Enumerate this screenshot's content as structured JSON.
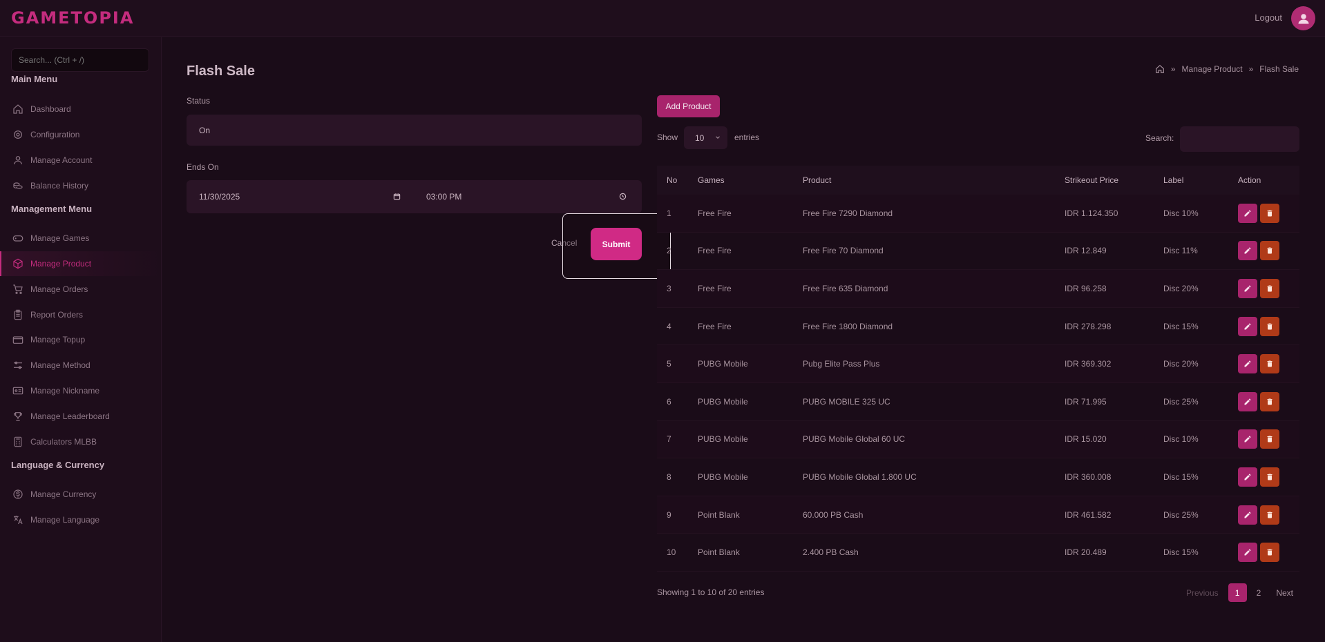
{
  "header": {
    "logo": "GAMETOPIA",
    "logout": "Logout"
  },
  "sidebar": {
    "search_placeholder": "Search... (Ctrl + /)",
    "sections": [
      {
        "title": "Main Menu",
        "items": [
          {
            "label": "Dashboard",
            "icon": "home-icon"
          },
          {
            "label": "Configuration",
            "icon": "gear-icon"
          },
          {
            "label": "Manage Account",
            "icon": "user-icon"
          },
          {
            "label": "Balance History",
            "icon": "coins-icon"
          }
        ]
      },
      {
        "title": "Management Menu",
        "items": [
          {
            "label": "Manage Games",
            "icon": "gamepad-icon"
          },
          {
            "label": "Manage Product",
            "icon": "box-icon",
            "active": true
          },
          {
            "label": "Manage Orders",
            "icon": "cart-icon"
          },
          {
            "label": "Report Orders",
            "icon": "clipboard-icon"
          },
          {
            "label": "Manage Topup",
            "icon": "wallet-icon"
          },
          {
            "label": "Manage Method",
            "icon": "sliders-icon"
          },
          {
            "label": "Manage Nickname",
            "icon": "id-card-icon"
          },
          {
            "label": "Manage Leaderboard",
            "icon": "trophy-icon"
          },
          {
            "label": "Calculators MLBB",
            "icon": "calculator-icon"
          }
        ]
      },
      {
        "title": "Language & Currency",
        "items": [
          {
            "label": "Manage Currency",
            "icon": "currency-icon"
          },
          {
            "label": "Manage Language",
            "icon": "translate-icon"
          }
        ]
      }
    ]
  },
  "page": {
    "title": "Flash Sale",
    "breadcrumb": [
      "Manage Product",
      "Flash Sale"
    ]
  },
  "form": {
    "status_label": "Status",
    "status_value": "On",
    "ends_label": "Ends On",
    "date_value": "11/30/2025",
    "time_value": "03:00 PM",
    "cancel": "Cancel",
    "submit": "Submit"
  },
  "table": {
    "add_button": "Add Product",
    "show_label": "Show",
    "entries_value": "10",
    "entries_label": "entries",
    "search_label": "Search:",
    "columns": [
      "No",
      "Games",
      "Product",
      "Strikeout Price",
      "Label",
      "Action"
    ],
    "rows": [
      [
        "1",
        "Free Fire",
        "Free Fire 7290 Diamond",
        "IDR 1.124.350",
        "Disc 10%"
      ],
      [
        "2",
        "Free Fire",
        "Free Fire 70 Diamond",
        "IDR 12.849",
        "Disc 11%"
      ],
      [
        "3",
        "Free Fire",
        "Free Fire 635 Diamond",
        "IDR 96.258",
        "Disc 20%"
      ],
      [
        "4",
        "Free Fire",
        "Free Fire 1800 Diamond",
        "IDR 278.298",
        "Disc 15%"
      ],
      [
        "5",
        "PUBG Mobile",
        "Pubg Elite Pass Plus",
        "IDR 369.302",
        "Disc 20%"
      ],
      [
        "6",
        "PUBG Mobile",
        "PUBG MOBILE 325 UC",
        "IDR 71.995",
        "Disc 25%"
      ],
      [
        "7",
        "PUBG Mobile",
        "PUBG Mobile Global 60 UC",
        "IDR 15.020",
        "Disc 10%"
      ],
      [
        "8",
        "PUBG Mobile",
        "PUBG Mobile Global 1.800 UC",
        "IDR 360.008",
        "Disc 15%"
      ],
      [
        "9",
        "Point Blank",
        "60.000 PB Cash",
        "IDR 461.582",
        "Disc 25%"
      ],
      [
        "10",
        "Point Blank",
        "2.400 PB Cash",
        "IDR 20.489",
        "Disc 15%"
      ]
    ],
    "footer": "Showing 1 to 10 of 20 entries",
    "pagination": {
      "previous": "Previous",
      "pages": [
        "1",
        "2"
      ],
      "active": "1",
      "next": "Next"
    }
  },
  "colors": {
    "accent": "#c42c7e",
    "delete": "#b03a18",
    "background": "#1a0c18"
  }
}
